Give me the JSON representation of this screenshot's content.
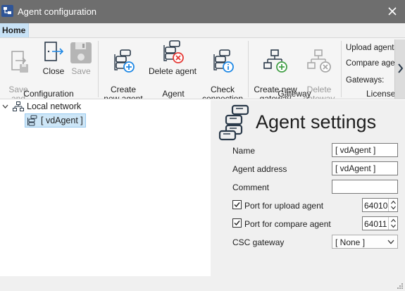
{
  "window": {
    "title": "Agent configuration"
  },
  "tabs": [
    {
      "label": "Home"
    }
  ],
  "ribbon": {
    "configuration": {
      "label": "Configuration",
      "save_and_close": "Save\nand Close",
      "close": "Close",
      "save": "Save"
    },
    "agent": {
      "label": "Agent",
      "create": "Create\nnew agent",
      "delete": "Delete agent",
      "check": "Check\nconnection"
    },
    "gateway": {
      "label": "Gateway",
      "create": "Create new\ngateway",
      "delete": "Delete\ngateway"
    },
    "license": {
      "label": "License",
      "upload_agents": "Upload agents",
      "compare_agents": "Compare agen",
      "gateways": "Gateways:"
    }
  },
  "tree": {
    "root": "Local network",
    "child": "[ vdAgent ]"
  },
  "settings": {
    "title": "Agent settings",
    "name_label": "Name",
    "name_value": "[ vdAgent ]",
    "address_label": "Agent address",
    "address_value": "[ vdAgent ]",
    "comment_label": "Comment",
    "comment_value": "",
    "upload_port_label": "Port for upload agent",
    "upload_port_value": "64010",
    "upload_port_checked": true,
    "compare_port_label": "Port for compare agent",
    "compare_port_value": "64011",
    "compare_port_checked": true,
    "gateway_label": "CSC gateway",
    "gateway_value": "[ None ]"
  },
  "colors": {
    "titlebar": "#6e6e6e",
    "tab_active": "#c8e2f6",
    "icon_dark": "#2b3a4a",
    "icon_blue": "#1e88e5",
    "icon_red": "#e53935",
    "icon_green": "#43a047",
    "selection": "#cde6f7"
  }
}
